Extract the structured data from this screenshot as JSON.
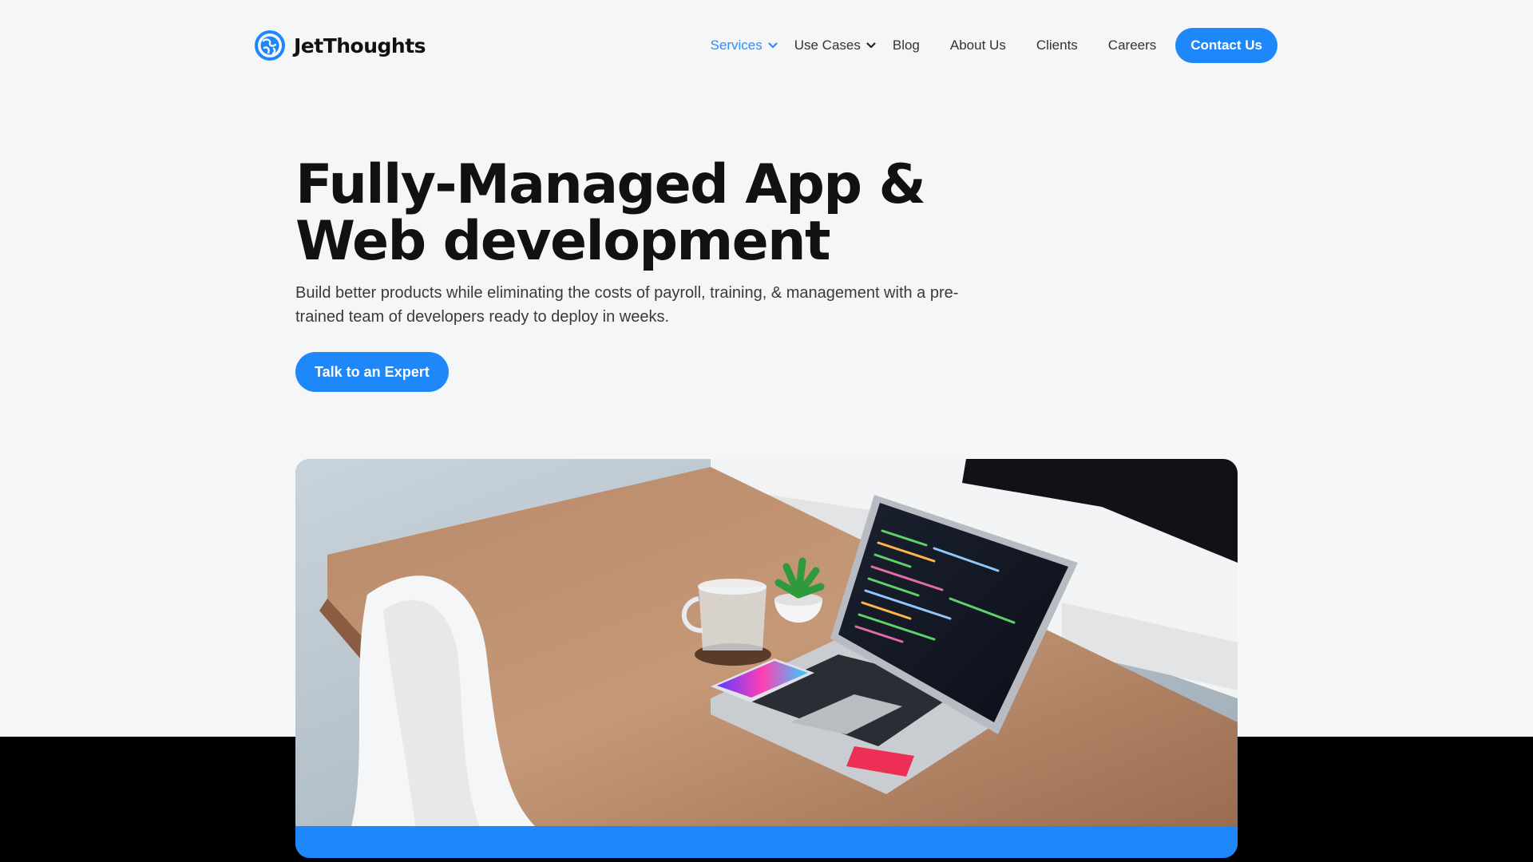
{
  "brand": {
    "name": "JetThoughts",
    "icon": "globe-logo-icon",
    "accent_color": "#1e88fb"
  },
  "nav": {
    "items": [
      {
        "label": "Services",
        "active": true,
        "has_dropdown": true
      },
      {
        "label": "Use Cases",
        "active": false,
        "has_dropdown": true
      },
      {
        "label": "Blog",
        "active": false,
        "has_dropdown": false
      },
      {
        "label": "About Us",
        "active": false,
        "has_dropdown": false
      },
      {
        "label": "Clients",
        "active": false,
        "has_dropdown": false
      },
      {
        "label": "Careers",
        "active": false,
        "has_dropdown": false
      }
    ],
    "contact_label": "Contact Us"
  },
  "hero": {
    "title": "Fully-Managed App & Web development",
    "subtitle": "Build better products while eliminating the costs of payroll, training, & management with a pre-trained team of developers ready to deploy in weeks.",
    "cta_label": "Talk to an Expert"
  },
  "hero_image": {
    "subject": "laptop with code on a wooden desk, phone, glass mug and potted succulent, white chair"
  }
}
